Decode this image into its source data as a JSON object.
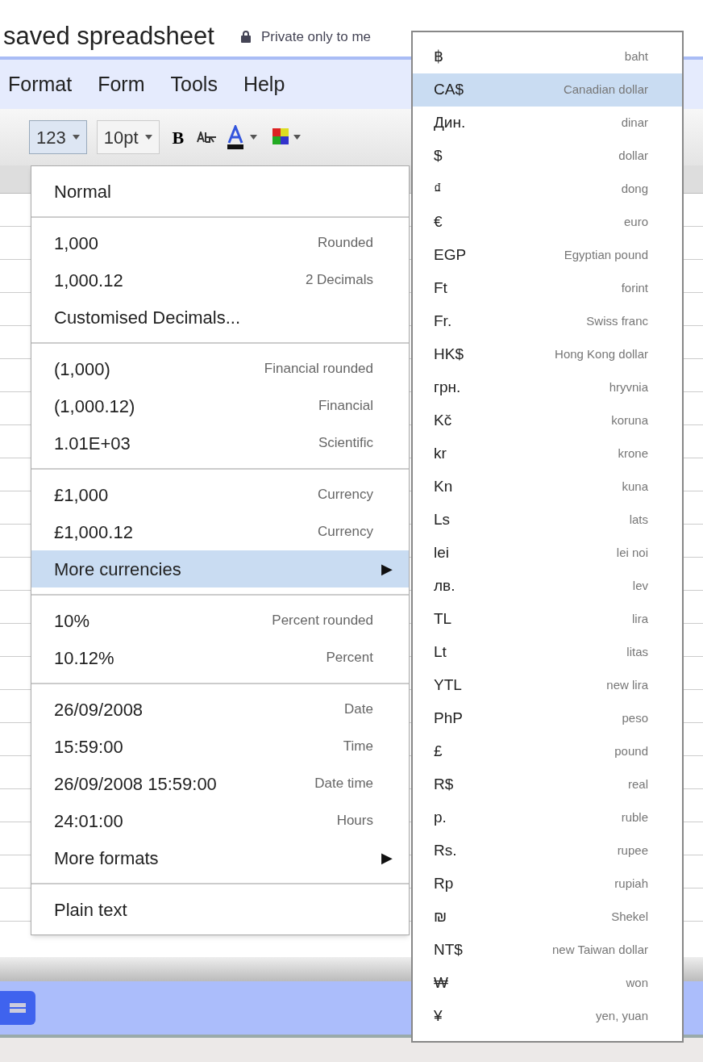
{
  "title": "saved spreadsheet",
  "privacy": "Private only to me",
  "menubar": [
    "Format",
    "Form",
    "Tools",
    "Help"
  ],
  "toolbar": {
    "number_format": "123",
    "font_size": "10pt",
    "bold": "B"
  },
  "format_menu": {
    "groups": [
      [
        {
          "kind": "item",
          "label": "Normal",
          "selected": false
        }
      ],
      [
        {
          "kind": "item",
          "label": "1,000",
          "hint": "Rounded",
          "selected": false
        },
        {
          "kind": "item",
          "label": "1,000.12",
          "hint": "2 Decimals",
          "selected": false
        },
        {
          "kind": "item",
          "label": "Customised Decimals...",
          "selected": false
        }
      ],
      [
        {
          "kind": "item",
          "label": "(1,000)",
          "hint": "Financial rounded",
          "selected": false
        },
        {
          "kind": "item",
          "label": "(1,000.12)",
          "hint": "Financial",
          "selected": false
        },
        {
          "kind": "item",
          "label": "1.01E+03",
          "hint": "Scientific",
          "selected": false
        }
      ],
      [
        {
          "kind": "item",
          "label": "£1,000",
          "hint": "Currency",
          "selected": false
        },
        {
          "kind": "item",
          "label": "£1,000.12",
          "hint": "Currency",
          "selected": false
        },
        {
          "kind": "submenu",
          "label": "More currencies",
          "arrow": "▶",
          "selected": true
        }
      ],
      [
        {
          "kind": "item",
          "label": "10%",
          "hint": "Percent rounded",
          "selected": false
        },
        {
          "kind": "item",
          "label": "10.12%",
          "hint": "Percent",
          "selected": false
        }
      ],
      [
        {
          "kind": "item",
          "label": "26/09/2008",
          "hint": "Date",
          "selected": false
        },
        {
          "kind": "item",
          "label": "15:59:00",
          "hint": "Time",
          "selected": false
        },
        {
          "kind": "item",
          "label": "26/09/2008 15:59:00",
          "hint": "Date time",
          "selected": false
        },
        {
          "kind": "item",
          "label": "24:01:00",
          "hint": "Hours",
          "selected": false
        },
        {
          "kind": "submenu",
          "label": "More formats",
          "arrow": "▶",
          "selected": false
        }
      ],
      [
        {
          "kind": "item",
          "label": "Plain text",
          "selected": false
        }
      ]
    ]
  },
  "currencies": [
    {
      "symbol": "฿",
      "name": "baht",
      "selected": false
    },
    {
      "symbol": "CA$",
      "name": "Canadian dollar",
      "selected": true
    },
    {
      "symbol": "Дин.",
      "name": "dinar",
      "selected": false
    },
    {
      "symbol": "$",
      "name": "dollar",
      "selected": false
    },
    {
      "symbol": "₫",
      "name": "dong",
      "selected": false
    },
    {
      "symbol": "€",
      "name": "euro",
      "selected": false
    },
    {
      "symbol": "EGP",
      "name": "Egyptian pound",
      "selected": false
    },
    {
      "symbol": "Ft",
      "name": "forint",
      "selected": false
    },
    {
      "symbol": "Fr.",
      "name": "Swiss franc",
      "selected": false
    },
    {
      "symbol": "HK$",
      "name": "Hong Kong dollar",
      "selected": false
    },
    {
      "symbol": "грн.",
      "name": "hryvnia",
      "selected": false
    },
    {
      "symbol": "Kč",
      "name": "koruna",
      "selected": false
    },
    {
      "symbol": "kr",
      "name": "krone",
      "selected": false
    },
    {
      "symbol": "Kn",
      "name": "kuna",
      "selected": false
    },
    {
      "symbol": "Ls",
      "name": "lats",
      "selected": false
    },
    {
      "symbol": "lei",
      "name": "lei noi",
      "selected": false
    },
    {
      "symbol": "лв.",
      "name": "lev",
      "selected": false
    },
    {
      "symbol": "TL",
      "name": "lira",
      "selected": false
    },
    {
      "symbol": "Lt",
      "name": "litas",
      "selected": false
    },
    {
      "symbol": "YTL",
      "name": "new lira",
      "selected": false
    },
    {
      "symbol": "PhP",
      "name": "peso",
      "selected": false
    },
    {
      "symbol": "£",
      "name": "pound",
      "selected": false
    },
    {
      "symbol": "R$",
      "name": "real",
      "selected": false
    },
    {
      "symbol": "р.",
      "name": "ruble",
      "selected": false
    },
    {
      "symbol": "Rs.",
      "name": "rupee",
      "selected": false
    },
    {
      "symbol": "Rp",
      "name": "rupiah",
      "selected": false
    },
    {
      "symbol": "₪",
      "name": "Shekel",
      "selected": false
    },
    {
      "symbol": "NT$",
      "name": "new Taiwan dollar",
      "selected": false
    },
    {
      "symbol": "₩",
      "name": "won",
      "selected": false
    },
    {
      "symbol": "¥",
      "name": "yen, yuan",
      "selected": false
    }
  ]
}
